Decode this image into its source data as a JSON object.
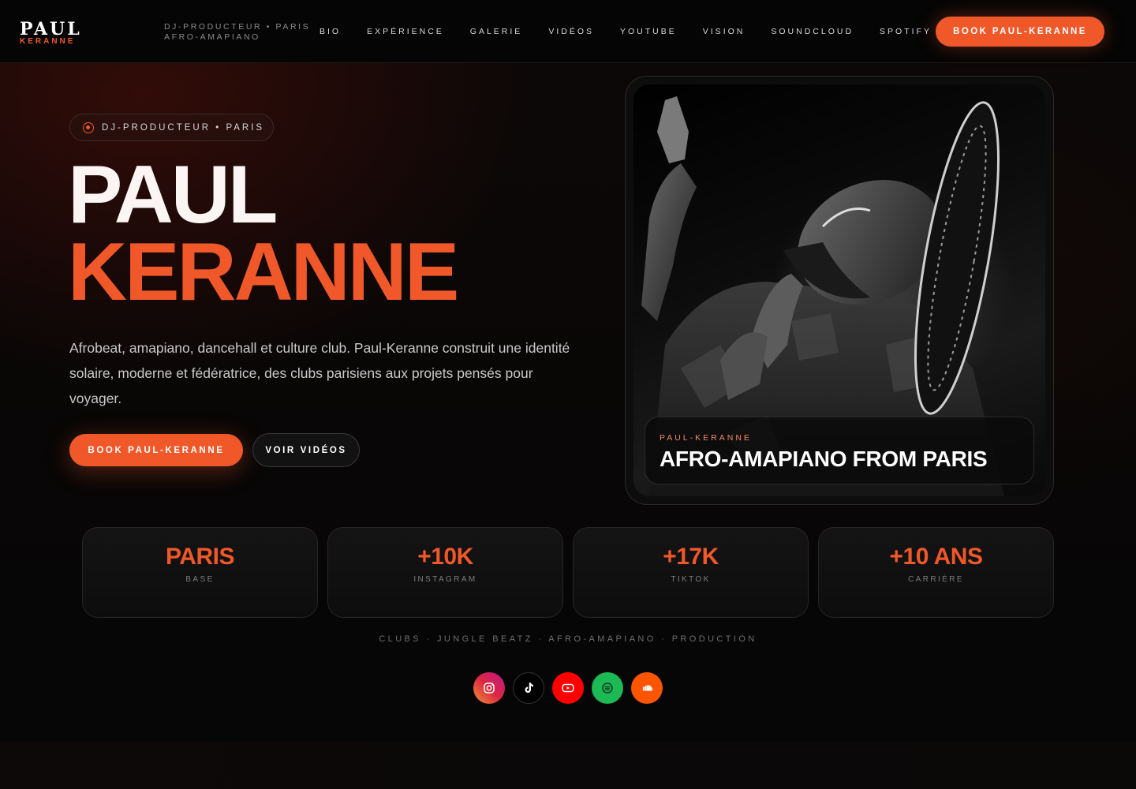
{
  "logo": {
    "top": "PAUL",
    "bottom": "KERANNE"
  },
  "tagline": {
    "line1": "DJ-PRODUCTEUR • PARIS",
    "line2": "AFRO-AMAPIANO"
  },
  "nav": {
    "items": [
      "BIO",
      "EXPÉRIENCE",
      "GALERIE",
      "VIDÉOS",
      "YOUTUBE",
      "VISION",
      "SOUNDCLOUD",
      "SPOTIFY"
    ],
    "cta": "BOOK PAUL-KERANNE"
  },
  "hero": {
    "pill": "DJ-PRODUCTEUR • PARIS",
    "first_name": "PAUL",
    "last_name": "KERANNE",
    "description": "Afrobeat, amapiano, dancehall et culture club. Paul-Keranne construit une identité solaire, moderne et fédératrice, des clubs parisiens aux projets pensés pour voyager.",
    "primary_button": "BOOK PAUL-KERANNE",
    "secondary_button": "VOIR VIDÉOS"
  },
  "photo_caption": {
    "small": "PAUL-KERANNE",
    "big": "AFRO-AMAPIANO FROM PARIS"
  },
  "stats": [
    {
      "value": "PARIS",
      "label": "BASE"
    },
    {
      "value": "+10K",
      "label": "INSTAGRAM"
    },
    {
      "value": "+17K",
      "label": "TIKTOK"
    },
    {
      "value": "+10 ANS",
      "label": "CARRIÈRE"
    }
  ],
  "tags_line": "CLUBS · JUNGLE BEATZ · AFRO-AMAPIANO · PRODUCTION",
  "socials": [
    {
      "name": "instagram-icon",
      "color": "#d6307a"
    },
    {
      "name": "tiktok-icon",
      "color": "#000000"
    },
    {
      "name": "youtube-icon",
      "color": "#ff0000"
    },
    {
      "name": "spotify-icon",
      "color": "#1db954"
    },
    {
      "name": "soundcloud-icon",
      "color": "#ff5500"
    }
  ],
  "colors": {
    "accent": "#f0582a",
    "background": "#070707"
  }
}
